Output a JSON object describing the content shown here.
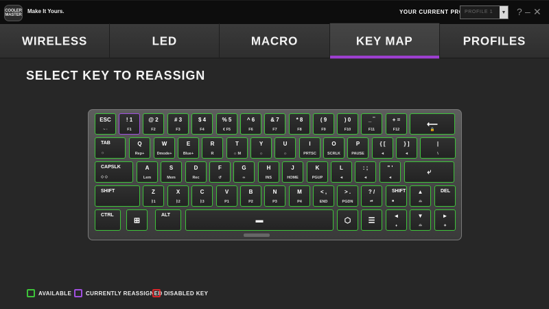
{
  "app": {
    "logo_text": "COOLER MASTER",
    "tagline": "Make It Yours."
  },
  "profile": {
    "label": "YOUR CURRENT PROFILE",
    "selected": "PROFILE 1"
  },
  "window_controls": {
    "help": "?",
    "minimize": "–",
    "close": "✕"
  },
  "tabs": [
    {
      "label": "WIRELESS",
      "active": false
    },
    {
      "label": "LED",
      "active": false
    },
    {
      "label": "MACRO",
      "active": false
    },
    {
      "label": "KEY MAP",
      "active": true
    },
    {
      "label": "PROFILES",
      "active": false
    }
  ],
  "section_title": "SELECT KEY TO REASSIGN",
  "colors": {
    "available": "#3ec43a",
    "reassigned": "#a14fe0",
    "disabled": "#d9262b",
    "accent": "#9d3fd0"
  },
  "keyboard": {
    "row1": [
      {
        "t": "ESC",
        "b": "~ ·"
      },
      {
        "t": "! 1",
        "b": "F1",
        "state": "reassigned"
      },
      {
        "t": "@ 2",
        "b": "F2"
      },
      {
        "t": "# 3",
        "b": "F3"
      },
      {
        "t": "$ 4",
        "b": "F4"
      },
      {
        "t": "% 5",
        "b": "€ F5"
      },
      {
        "t": "^ 6",
        "b": "F6"
      },
      {
        "t": "& 7",
        "b": "F7"
      },
      {
        "t": "* 8",
        "b": "F8"
      },
      {
        "t": "( 9",
        "b": "F9"
      },
      {
        "t": ") 0",
        "b": "F10"
      },
      {
        "t": "_ ‾",
        "b": "F11"
      },
      {
        "t": "+ =",
        "b": "F12"
      },
      {
        "t": "⟵",
        "b": "🔒"
      }
    ],
    "row2": [
      {
        "t": "TAB",
        "b": "☼"
      },
      {
        "t": "Q",
        "b": "Rep+"
      },
      {
        "t": "W",
        "b": "Dmode+"
      },
      {
        "t": "E",
        "b": "Blue+"
      },
      {
        "t": "R",
        "b": "R"
      },
      {
        "t": "T",
        "b": "☼ M"
      },
      {
        "t": "Y",
        "b": "☼"
      },
      {
        "t": "U",
        "b": "☼"
      },
      {
        "t": "I",
        "b": "PRTSC"
      },
      {
        "t": "O",
        "b": "SCRLK"
      },
      {
        "t": "P",
        "b": "PAUSE"
      },
      {
        "t": "{ [",
        "b": "◄"
      },
      {
        "t": "} ]",
        "b": "◄"
      },
      {
        "t": "|",
        "b": "\\"
      }
    ],
    "row3": [
      {
        "t": "CAPSLK",
        "b": "◇ ◇"
      },
      {
        "t": "A",
        "b": "Lem"
      },
      {
        "t": "S",
        "b": "Mem"
      },
      {
        "t": "D",
        "b": "Rec"
      },
      {
        "t": "F",
        "b": "↺"
      },
      {
        "t": "G",
        "b": "∞"
      },
      {
        "t": "H",
        "b": "INS"
      },
      {
        "t": "J",
        "b": "HOME"
      },
      {
        "t": "K",
        "b": "PGUP"
      },
      {
        "t": "L",
        "b": "◄"
      },
      {
        "t": ": ;",
        "b": "◄"
      },
      {
        "t": "\" '",
        "b": "◄"
      },
      {
        "t": "⤶",
        "b": ""
      }
    ],
    "row4": [
      {
        "t": "SHIFT",
        "b": ""
      },
      {
        "t": "Z",
        "b": "ᛒ1"
      },
      {
        "t": "X",
        "b": "ᛒ2"
      },
      {
        "t": "C",
        "b": "ᛒ3"
      },
      {
        "t": "V",
        "b": "P1"
      },
      {
        "t": "B",
        "b": "P2"
      },
      {
        "t": "N",
        "b": "P3"
      },
      {
        "t": "M",
        "b": "P4"
      },
      {
        "t": "< ,",
        "b": "END"
      },
      {
        "t": "> .",
        "b": "PGDN"
      },
      {
        "t": "? /",
        "b": "⏯"
      },
      {
        "t": "SHIFT",
        "b": "■"
      },
      {
        "t": "▲",
        "b": "⌓"
      },
      {
        "t": "DEL",
        "b": ""
      }
    ],
    "row5": [
      {
        "t": "CTRL",
        "b": ""
      },
      {
        "t": "⊞",
        "b": ""
      },
      {
        "t": "ALT",
        "b": ""
      },
      {
        "t": "▬",
        "b": ""
      },
      {
        "t": "⬡",
        "b": ""
      },
      {
        "t": "☰",
        "b": ""
      },
      {
        "t": "◄",
        "b": "♦"
      },
      {
        "t": "▼",
        "b": "⌓"
      },
      {
        "t": "►",
        "b": "✦"
      }
    ]
  },
  "legend": [
    {
      "label": "AVAILABLE",
      "color": "#3ec43a"
    },
    {
      "label": "CURRENTLY REASSIGNED",
      "color": "#a14fe0"
    },
    {
      "label": "DISABLED KEY",
      "color": "#d9262b"
    }
  ]
}
